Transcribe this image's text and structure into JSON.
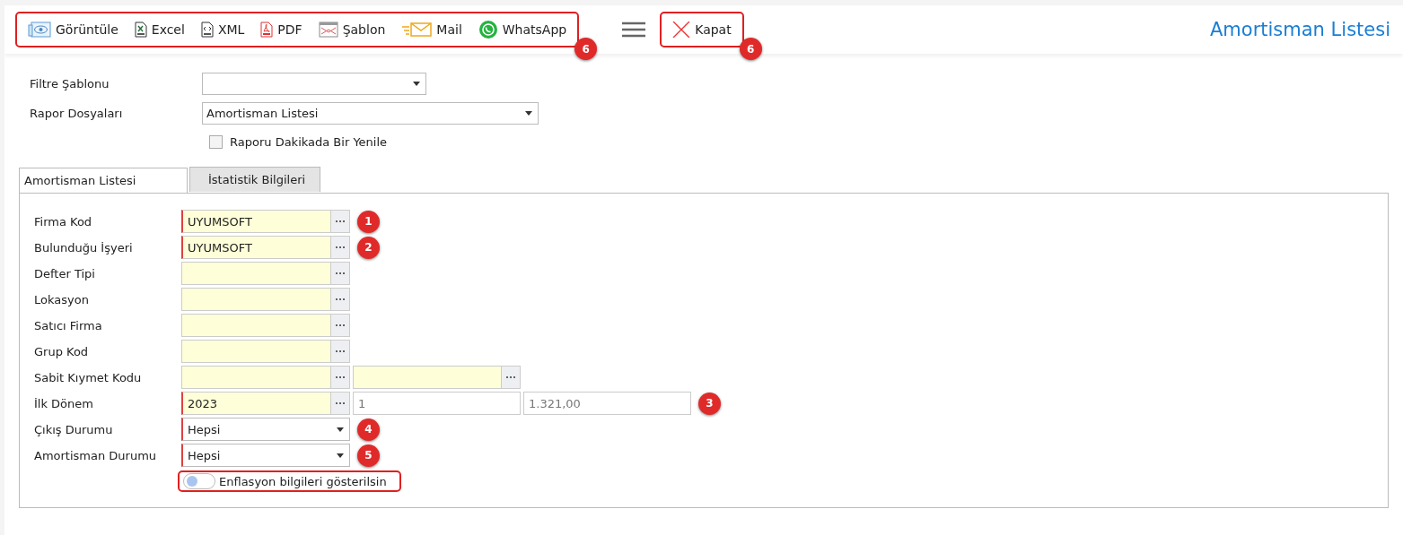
{
  "toolbar": {
    "items": [
      {
        "label": "Görüntüle"
      },
      {
        "label": "Excel"
      },
      {
        "label": "XML"
      },
      {
        "label": "PDF"
      },
      {
        "label": "Şablon"
      },
      {
        "label": "Mail"
      },
      {
        "label": "WhatsApp"
      }
    ],
    "badge": "6",
    "close": {
      "label": "Kapat",
      "badge": "6"
    }
  },
  "title": "Amortisman Listesi",
  "filters": [
    {
      "label": "Filtre Şablonu"
    },
    {
      "label": "Rapor Dosyaları",
      "value": "Amortisman Listesi"
    }
  ],
  "refresh": {
    "label": "Raporu Dakikada Bir Yenile",
    "checked": false
  },
  "tabs": [
    {
      "label": "Amortisman Listesi",
      "selected": true
    },
    {
      "label": "İstatistik Bilgileri",
      "selected": false
    }
  ],
  "rows": [
    {
      "kind": "lookup",
      "label": "Firma Kod",
      "required": true,
      "value": "UYUMSOFT",
      "badge": "1"
    },
    {
      "kind": "lookup",
      "label": "Bulunduğu İşyeri",
      "required": true,
      "value": "UYUMSOFT",
      "badge": "2"
    },
    {
      "kind": "lookup",
      "label": "Defter Tipi",
      "required": false
    },
    {
      "kind": "lookup",
      "label": "Lokasyon",
      "required": false
    },
    {
      "kind": "lookup",
      "label": "Satıcı Firma",
      "required": false
    },
    {
      "kind": "lookup",
      "label": "Grup Kod",
      "required": false
    },
    {
      "kind": "lookup2",
      "label": "Sabit Kıymet Kodu",
      "required": false
    },
    {
      "kind": "period",
      "label": "İlk Dönem",
      "required": true,
      "value": "2023",
      "value2": "1",
      "value3": "1.321,00",
      "badge": "3"
    },
    {
      "kind": "select",
      "label": "Çıkış Durumu",
      "required": true,
      "value": "Hepsi",
      "badge": "4"
    },
    {
      "kind": "select",
      "label": "Amortisman Durumu",
      "required": true,
      "value": "Hepsi",
      "badge": "5"
    }
  ],
  "inflation": {
    "label": "Enflasyon bilgileri gösterilsin",
    "on": false
  }
}
